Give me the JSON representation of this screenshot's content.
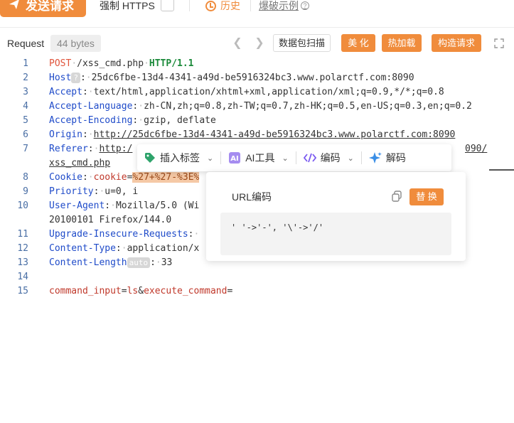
{
  "toolbar": {
    "send_label": "发送请求",
    "https_label": "强制 HTTPS",
    "history_label": "历史",
    "brute_label": "爆破示例"
  },
  "request_bar": {
    "title": "Request",
    "bytes": "44 bytes",
    "scan_label": "数据包扫描",
    "beautify_label": "美 化",
    "hotload_label": "热加载",
    "build_label": "构造请求"
  },
  "editor": {
    "line_numbers": [
      "1",
      "2",
      "3",
      "4",
      "5",
      "6",
      "7",
      "",
      "8",
      "9",
      "10",
      "",
      "11",
      "12",
      "13",
      "14",
      "15"
    ],
    "method": "POST",
    "path": "/xss_cmd.php",
    "protocol": "HTTP/1.1",
    "host_key": "Host",
    "host_badge": "?",
    "host_val": "25dc6fbe-13d4-4341-a49d-be5916324bc3.www.polarctf.com:8090",
    "accept_key": "Accept",
    "accept_val": "text/html,application/xhtml+xml,application/xml;q=0.9,*/*;q=0.8",
    "accept_lang_key": "Accept-Language",
    "accept_lang_val": "zh-CN,zh;q=0.8,zh-TW;q=0.7,zh-HK;q=0.5,en-US;q=0.3,en;q=0.2",
    "accept_enc_key": "Accept-Encoding",
    "accept_enc_val": "gzip, deflate",
    "origin_key": "Origin",
    "origin_val": "http://25dc6fbe-13d4-4341-a49d-be5916324bc3.www.polarctf.com:8090",
    "referer_key": "Referer",
    "referer_val_start": "http:/",
    "referer_val_end": "090/",
    "referer_wrap": "xss_cmd.php",
    "cookie_key": "Cookie",
    "cookie_name": "cookie",
    "cookie_eq": "=",
    "cookie_val": "%27+%27-%3E%",
    "priority_key": "Priority",
    "priority_val": "u=0, i",
    "ua_key": "User-Agent",
    "ua_val": "Mozilla/5.0 (Wi",
    "ua_wrap": "20100101 Firefox/144.0",
    "upgrade_key": "Upgrade-Insecure-Requests",
    "ctype_key": "Content-Type",
    "ctype_val": "application/x",
    "clen_key": "Content-Length",
    "clen_badge": "auto",
    "clen_val": "33",
    "body_k1": "command_input",
    "body_eq1": "=",
    "body_v1": "ls",
    "body_amp": "&",
    "body_k2": "execute_command",
    "body_eq2": "="
  },
  "context_bar": {
    "tag_label": "插入标签",
    "ai_label": "AI工具",
    "encode_label": "编码",
    "decode_label": "解码"
  },
  "popup": {
    "title": "URL编码",
    "replace_label": "替 换",
    "content": "' '->'-', '\\'->'/'"
  },
  "colors": {
    "accent": "#f08c3c",
    "header_key": "#1f4bc9",
    "method": "#e0533a",
    "protocol": "#1b8a3a"
  }
}
